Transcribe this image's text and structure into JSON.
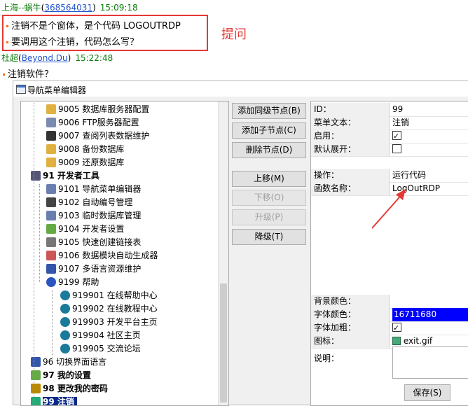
{
  "chat": {
    "msg1": {
      "name": "上海--蜗牛",
      "uid": "368564031",
      "time": "15:09:18"
    },
    "question": [
      "注销不是个窗体，是个代码 LOGOUTRDP",
      "要调用这个注销，代码怎么写？"
    ],
    "annotation": "提问",
    "msg2": {
      "name": "杜超",
      "uid": "Beyond.Du",
      "time": "15:22:48"
    },
    "reply": "注销软件？"
  },
  "window": {
    "title": "导航菜单编辑器",
    "tree": [
      {
        "label": "9005 数据库服务器配置",
        "icon": "db-icon"
      },
      {
        "label": "9006 FTP服务器配置",
        "icon": "doc-icon"
      },
      {
        "label": "9007 查阅列表数据维护",
        "icon": "table-icon"
      },
      {
        "label": "9008 备份数据库",
        "icon": "db-icon"
      },
      {
        "label": "9009 还原数据库",
        "icon": "db-icon"
      },
      {
        "label": "91 开发者工具",
        "icon": "tools-icon",
        "bold": true
      },
      {
        "label": "9101 导航菜单编辑器",
        "icon": "edit-icon"
      },
      {
        "label": "9102 自动编号管理",
        "icon": "list-icon"
      },
      {
        "label": "9103 临时数据库管理",
        "icon": "edit-icon"
      },
      {
        "label": "9104 开发者设置",
        "icon": "gear-icon"
      },
      {
        "label": "9105 快速创建链接表",
        "icon": "link-icon"
      },
      {
        "label": "9106 数据模块自动生成器",
        "icon": "wand-icon"
      },
      {
        "label": "9107 多语言资源维护",
        "icon": "chart-icon"
      },
      {
        "label": "9199 帮助",
        "icon": "help-icon"
      },
      {
        "label": "919901 在线帮助中心",
        "icon": "globe-icon"
      },
      {
        "label": "919902 在线教程中心",
        "icon": "globe-icon"
      },
      {
        "label": "919903 开发平台主页",
        "icon": "globe-icon"
      },
      {
        "label": "919904 社区主页",
        "icon": "globe-icon"
      },
      {
        "label": "919905 交流论坛",
        "icon": "globe-icon"
      },
      {
        "label": "96 切换界面语言",
        "icon": "chart-icon"
      },
      {
        "label": "97 我的设置",
        "icon": "gear-icon",
        "bold": true
      },
      {
        "label": "98 更改我的密码",
        "icon": "key-icon",
        "bold": true
      },
      {
        "label": "99 注销",
        "icon": "exit-icon",
        "bold": true,
        "selected": true
      }
    ],
    "buttons": {
      "add_sibling": "添加同级节点(B)",
      "add_child": "添加子节点(C)",
      "delete": "删除节点(D)",
      "move_up": "上移(M)",
      "move_down": "下移(O)",
      "promote": "升级(P)",
      "demote": "降级(T)",
      "save": "保存(S)"
    },
    "props": {
      "id_k": "ID：",
      "id_v": "99",
      "text_k": "菜单文本：",
      "text_v": "注销",
      "enabled_k": "启用：",
      "expand_k": "默认展开：",
      "op_k": "操作：",
      "op_v": "运行代码",
      "fn_k": "函数名称：",
      "fn_v": "LogOutRDP",
      "bg_k": "背景颜色：",
      "fc_k": "字体颜色：",
      "fc_v": "16711680",
      "bold_k": "字体加粗：",
      "icon_k": "图标：",
      "icon_v": "exit.gif",
      "desc_k": "说明："
    },
    "colors": {
      "accent": "#e53935",
      "selected": "#0a2a8a",
      "font_color": "#0000ff"
    }
  }
}
